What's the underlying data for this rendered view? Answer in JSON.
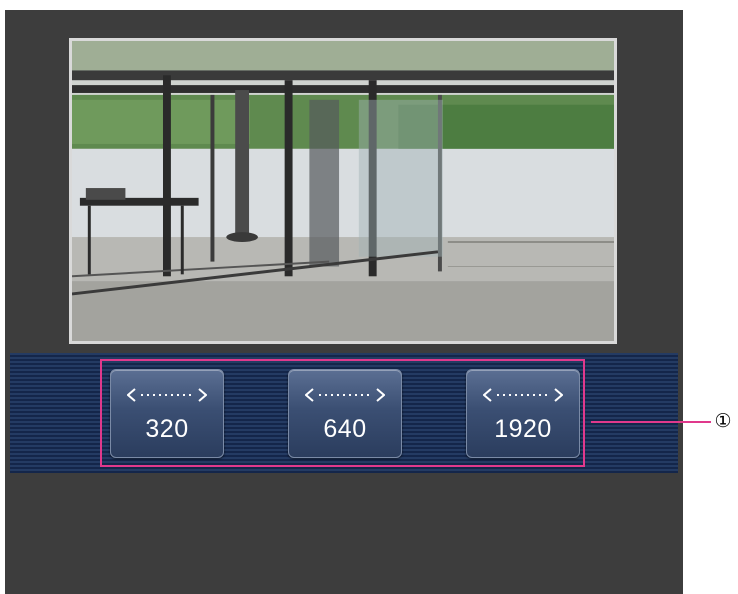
{
  "resize_buttons": [
    {
      "label": "320"
    },
    {
      "label": "640"
    },
    {
      "label": "1920"
    }
  ],
  "callout": {
    "number": "①"
  },
  "colors": {
    "background": "#3d3d3d",
    "control_bar": "#1c2f55",
    "button": "#3b4f73",
    "callout": "#e0398c"
  },
  "icons": {
    "resize": "horizontal-double-arrow-icon"
  }
}
